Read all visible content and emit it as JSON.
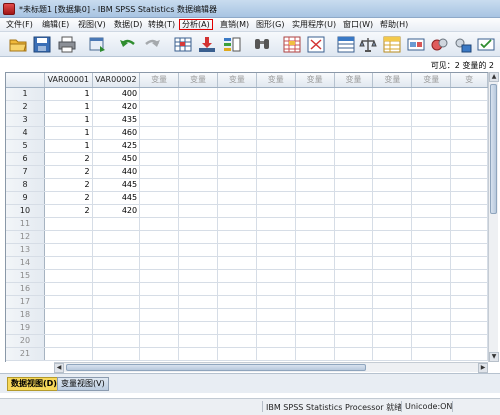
{
  "window": {
    "title": "*未标题1 [数据集0] - IBM SPSS Statistics 数据编辑器"
  },
  "menu": {
    "items": [
      {
        "label": "文件(F)"
      },
      {
        "label": "编辑(E)"
      },
      {
        "label": "视图(V)"
      },
      {
        "label": "数据(D)"
      },
      {
        "label": "转换(T)"
      },
      {
        "label": "分析(A)",
        "highlighted": true
      },
      {
        "label": "直销(M)"
      },
      {
        "label": "图形(G)"
      },
      {
        "label": "实用程序(U)"
      },
      {
        "label": "窗口(W)"
      },
      {
        "label": "帮助(H)"
      }
    ]
  },
  "toolbar": {
    "icons": [
      "open-folder-icon",
      "save-icon",
      "print-icon",
      "dialog-recall-icon",
      "undo-icon",
      "redo-icon",
      "goto-case-icon",
      "goto-variable-icon",
      "variables-icon",
      "find-icon",
      "insert-cases-icon",
      "insert-variable-icon",
      "split-file-icon",
      "weight-cases-icon",
      "select-cases-icon",
      "value-labels-icon",
      "use-sets-icon"
    ]
  },
  "visible": {
    "label": "可见：2 变量的 2"
  },
  "grid": {
    "columns": [
      "VAR00001",
      "VAR00002",
      "变量",
      "变量",
      "变量",
      "变量",
      "变量",
      "变量",
      "变量",
      "变量",
      "变"
    ],
    "rows": [
      {
        "n": "1",
        "v1": "1",
        "v2": "400"
      },
      {
        "n": "2",
        "v1": "1",
        "v2": "420"
      },
      {
        "n": "3",
        "v1": "1",
        "v2": "435"
      },
      {
        "n": "4",
        "v1": "1",
        "v2": "460"
      },
      {
        "n": "5",
        "v1": "1",
        "v2": "425"
      },
      {
        "n": "6",
        "v1": "2",
        "v2": "450"
      },
      {
        "n": "7",
        "v1": "2",
        "v2": "440"
      },
      {
        "n": "8",
        "v1": "2",
        "v2": "445"
      },
      {
        "n": "9",
        "v1": "2",
        "v2": "445"
      },
      {
        "n": "10",
        "v1": "2",
        "v2": "420"
      }
    ],
    "empty_rows": [
      "11",
      "12",
      "13",
      "14",
      "15",
      "16",
      "17",
      "18",
      "19",
      "20",
      "21"
    ]
  },
  "tabs": {
    "data_view": "数据视图(D)",
    "variable_view": "变量视图(V)"
  },
  "status": {
    "processor": "IBM SPSS Statistics Processor 就绪",
    "unicode": "Unicode:ON"
  },
  "colors": {
    "active_tab": "#f7d85a",
    "highlight_border": "#e00000"
  }
}
